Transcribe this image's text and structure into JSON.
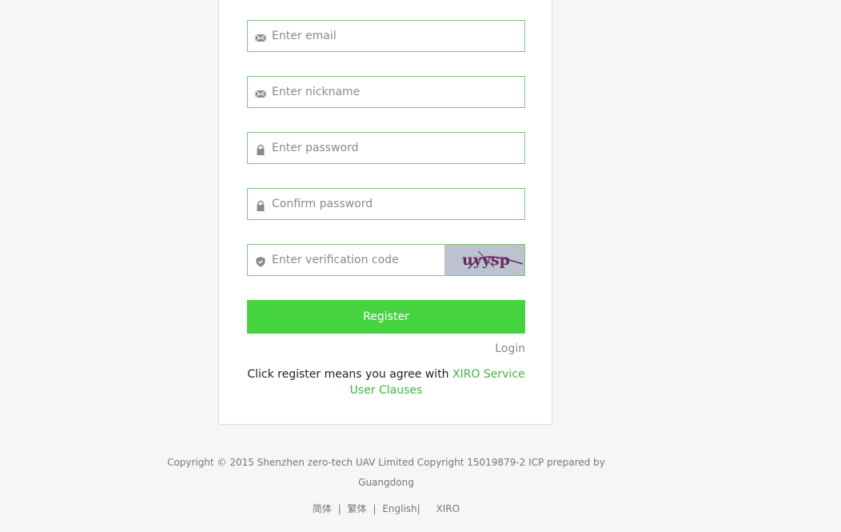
{
  "form": {
    "email_placeholder": "Enter email",
    "nickname_placeholder": "Enter nickname",
    "password_placeholder": "Enter password",
    "confirm_placeholder": "Confirm password",
    "verification_placeholder": "Enter verification code",
    "captcha_text": "uyysp",
    "register_label": "Register",
    "login_label": "Login",
    "agree_text": "Click register means you agree with ",
    "agree_link": "XIRO Service User Clauses"
  },
  "footer": {
    "copyright": "Copyright © 2015 Shenzhen zero-tech UAV Limited Copyright 15019879-2 ICP prepared by Guangdong",
    "links": [
      "简体",
      "繁体",
      "English"
    ],
    "sep1": "|",
    "sep2": "|",
    "sep3": "|",
    "brand": "XIRO"
  },
  "colors": {
    "accent": "#46d340",
    "link": "#3fb53f",
    "border": "#7ac77a",
    "background": "#f6f6f6"
  },
  "icons": {
    "email": "envelope-icon",
    "nickname": "envelope-icon",
    "password": "lock-icon",
    "confirm": "lock-icon",
    "verification": "shield-check-icon"
  }
}
